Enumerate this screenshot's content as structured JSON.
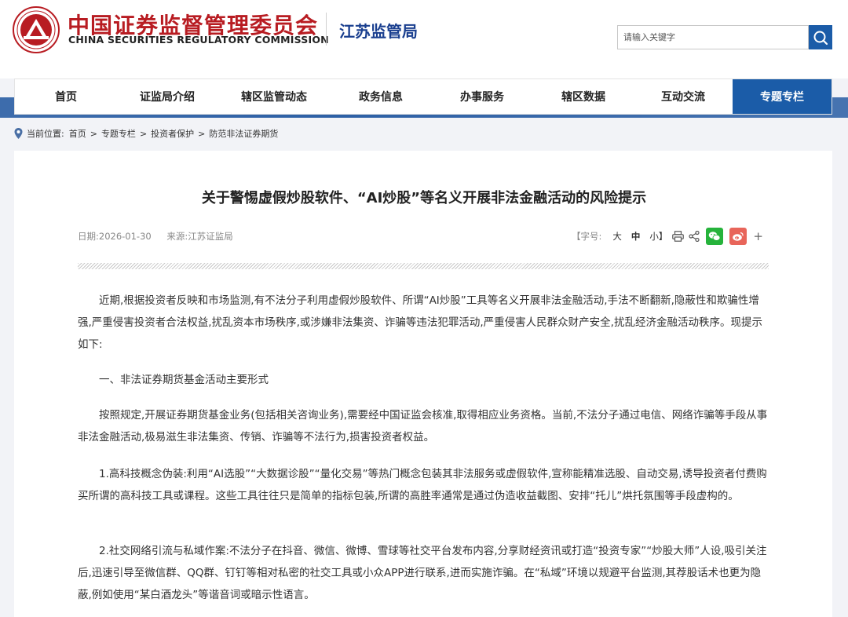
{
  "header": {
    "title_cn": "中国证券监督管理委员会",
    "title_en": "CHINA SECURITIES REGULATORY COMMISSION",
    "bureau": "江苏监管局",
    "search_placeholder": "请输入关键字",
    "logo_icon": "csrc-emblem-icon",
    "search_icon": "search-icon"
  },
  "nav": {
    "items": [
      {
        "label": "首页"
      },
      {
        "label": "证监局介绍"
      },
      {
        "label": "辖区监管动态"
      },
      {
        "label": "政务信息"
      },
      {
        "label": "办事服务"
      },
      {
        "label": "辖区数据"
      },
      {
        "label": "互动交流"
      },
      {
        "label": "专题专栏"
      }
    ],
    "active_index": 7
  },
  "breadcrumb": {
    "prefix": "当前位置:",
    "items": [
      "首页",
      "专题专栏",
      "投资者保护",
      "防范非法证券期货"
    ],
    "separator": ">"
  },
  "article": {
    "title": "关于警惕虚假炒股软件、“AI炒股”等名义开展非法金融活动的风险提示",
    "date": "日期:2026-01-30",
    "source": "来源:江苏证监局",
    "font_size_label": "【字号:",
    "font_sizes": [
      "大",
      "中",
      "小】"
    ],
    "paragraphs": [
      "近期,根据投资者反映和市场监测,有不法分子利用虚假炒股软件、所谓“AI炒股”工具等名义开展非法金融活动,手法不断翻新,隐蔽性和欺骗性增强,严重侵害投资者合法权益,扰乱资本市场秩序,或涉嫌非法集资、诈骗等违法犯罪活动,严重侵害人民群众财产安全,扰乱经济金融活动秩序。现提示如下:",
      "一、非法证券期货基金活动主要形式",
      "按照规定,开展证券期货基金业务(包括相关咨询业务),需要经中国证监会核准,取得相应业务资格。当前,不法分子通过电信、网络诈骗等手段从事非法金融活动,极易滋生非法集资、传销、诈骗等不法行为,损害投资者权益。",
      "1.高科技概念伪装:利用“AI选股”“大数据诊股”“量化交易”等热门概念包装其非法服务或虚假软件,宣称能精准选股、自动交易,诱导投资者付费购买所谓的高科技工具或课程。这些工具往往只是简单的指标包装,所谓的高胜率通常是通过伪造收益截图、安排“托儿”烘托氛围等手段虚构的。",
      "2.社交网络引流与私域作案:不法分子在抖音、微信、微博、雪球等社交平台发布内容,分享财经资讯或打造“投资专家”“炒股大师”人设,吸引关注后,迅速引导至微信群、QQ群、钉钉等相对私密的社交工具或小众APP进行联系,进而实施诈骗。在“私域”环境以规避平台监测,其荐股话术也更为隐蔽,例如使用“某白酒龙头”等谐音词或暗示性语言。"
    ]
  },
  "colors": {
    "brand_red": "#b81c22",
    "brand_blue": "#1b5ca8",
    "wechat_green": "#26b33b",
    "weibo_red": "#e8655a"
  }
}
